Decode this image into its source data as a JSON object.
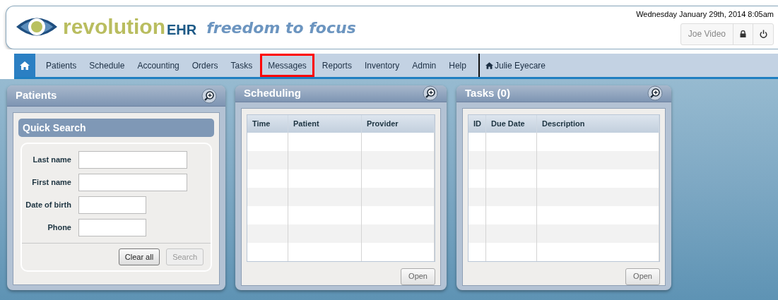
{
  "header": {
    "logo": {
      "brand": "revolution",
      "suffix": "EHR"
    },
    "tagline": "freedom to focus",
    "datetime": "Wednesday January 29th, 2014 8:05am",
    "user": "Joe Video"
  },
  "nav": {
    "items": [
      {
        "label": "Patients",
        "highlighted": false
      },
      {
        "label": "Schedule",
        "highlighted": false
      },
      {
        "label": "Accounting",
        "highlighted": false
      },
      {
        "label": "Orders",
        "highlighted": false
      },
      {
        "label": "Tasks",
        "highlighted": false
      },
      {
        "label": "Messages",
        "highlighted": true
      },
      {
        "label": "Reports",
        "highlighted": false
      },
      {
        "label": "Inventory",
        "highlighted": false
      },
      {
        "label": "Admin",
        "highlighted": false
      },
      {
        "label": "Help",
        "highlighted": false
      }
    ],
    "location": "Julie Eyecare"
  },
  "patients_panel": {
    "title": "Patients",
    "quick_search": {
      "title": "Quick Search",
      "fields": [
        {
          "label": "Last name",
          "kind": "wide"
        },
        {
          "label": "First name",
          "kind": "wide"
        },
        {
          "label": "Date of birth",
          "kind": "narrow"
        },
        {
          "label": "Phone",
          "kind": "narrow"
        }
      ],
      "buttons": [
        {
          "label": "Clear all",
          "disabled": false
        },
        {
          "label": "Search",
          "disabled": true
        }
      ]
    }
  },
  "scheduling_panel": {
    "title": "Scheduling",
    "table": {
      "columns": [
        "Time",
        "Patient",
        "Provider"
      ]
    },
    "button": "Open"
  },
  "tasks_panel": {
    "title": "Tasks (0)",
    "table": {
      "columns": [
        "ID",
        "Due Date",
        "Description"
      ]
    },
    "button": "Open"
  }
}
